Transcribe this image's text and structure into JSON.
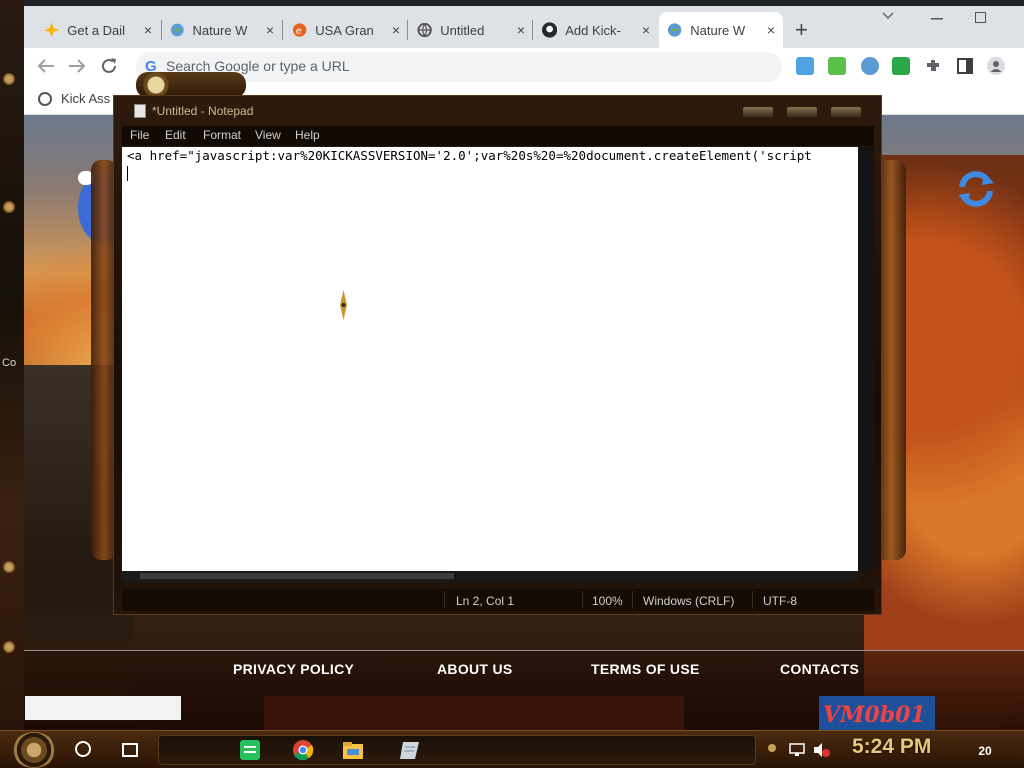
{
  "browser": {
    "tabs": [
      {
        "label": "Get a Dail",
        "active": false
      },
      {
        "label": "Nature W",
        "active": false
      },
      {
        "label": "USA Gran",
        "active": false
      },
      {
        "label": "Untitled",
        "active": false
      },
      {
        "label": "Add Kick-",
        "active": false
      },
      {
        "label": "Nature W",
        "active": true
      }
    ],
    "tab_close_glyph": "×",
    "new_tab_glyph": "+",
    "omnibox_placeholder": "Search Google or type a URL",
    "omnibox_g": "G",
    "bookmark_label": "Kick Ass"
  },
  "desktop": {
    "side_text": "Co"
  },
  "notepad": {
    "title": "*Untitled - Notepad",
    "menu": [
      "File",
      "Edit",
      "Format",
      "View",
      "Help"
    ],
    "content": "<a href=\"javascript:var%20KICKASSVERSION='2.0';var%20s%20=%20document.createElement('script",
    "status": {
      "position": "Ln 2, Col 1",
      "zoom": "100%",
      "line_ending": "Windows (CRLF)",
      "encoding": "UTF-8"
    }
  },
  "page_footer": {
    "links": [
      "PRIVACY POLICY",
      "ABOUT US",
      "TERMS OF USE",
      "CONTACTS"
    ],
    "logo_text": "VM0b01"
  },
  "taskbar": {
    "clock": "5:24 PM",
    "notification_count": "20"
  },
  "icons": {
    "back": "back-arrow-icon",
    "forward": "forward-arrow-icon",
    "reload": "reload-icon"
  }
}
